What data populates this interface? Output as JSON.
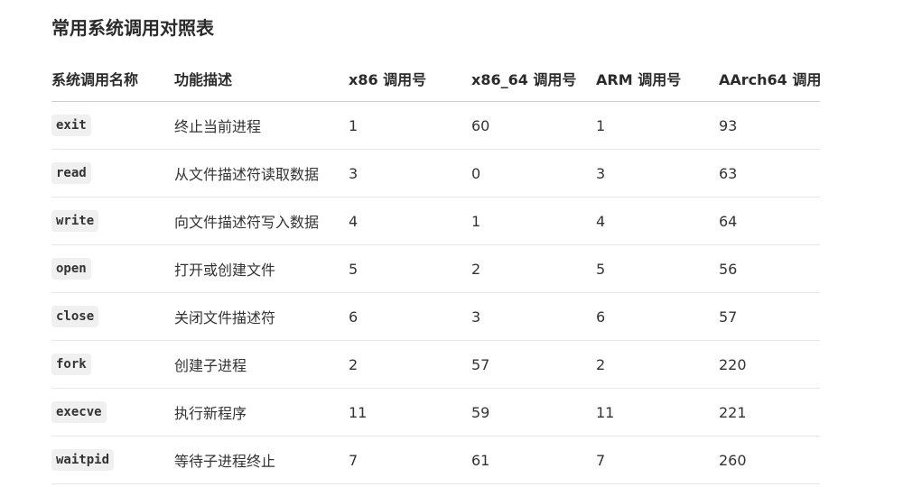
{
  "title": "常用系统调用对照表",
  "table": {
    "headers": [
      "系统调用名称",
      "功能描述",
      "x86 调用号",
      "x86_64 调用号",
      "ARM 调用号",
      "AArch64 调用"
    ],
    "rows": [
      {
        "name": "exit",
        "desc": "终止当前进程",
        "x86": "1",
        "x86_64": "60",
        "arm": "1",
        "aarch64": "93"
      },
      {
        "name": "read",
        "desc": "从文件描述符读取数据",
        "x86": "3",
        "x86_64": "0",
        "arm": "3",
        "aarch64": "63"
      },
      {
        "name": "write",
        "desc": "向文件描述符写入数据",
        "x86": "4",
        "x86_64": "1",
        "arm": "4",
        "aarch64": "64"
      },
      {
        "name": "open",
        "desc": "打开或创建文件",
        "x86": "5",
        "x86_64": "2",
        "arm": "5",
        "aarch64": "56"
      },
      {
        "name": "close",
        "desc": "关闭文件描述符",
        "x86": "6",
        "x86_64": "3",
        "arm": "6",
        "aarch64": "57"
      },
      {
        "name": "fork",
        "desc": "创建子进程",
        "x86": "2",
        "x86_64": "57",
        "arm": "2",
        "aarch64": "220"
      },
      {
        "name": "execve",
        "desc": "执行新程序",
        "x86": "11",
        "x86_64": "59",
        "arm": "11",
        "aarch64": "221"
      },
      {
        "name": "waitpid",
        "desc": "等待子进程终止",
        "x86": "7",
        "x86_64": "61",
        "arm": "7",
        "aarch64": "260"
      }
    ]
  }
}
